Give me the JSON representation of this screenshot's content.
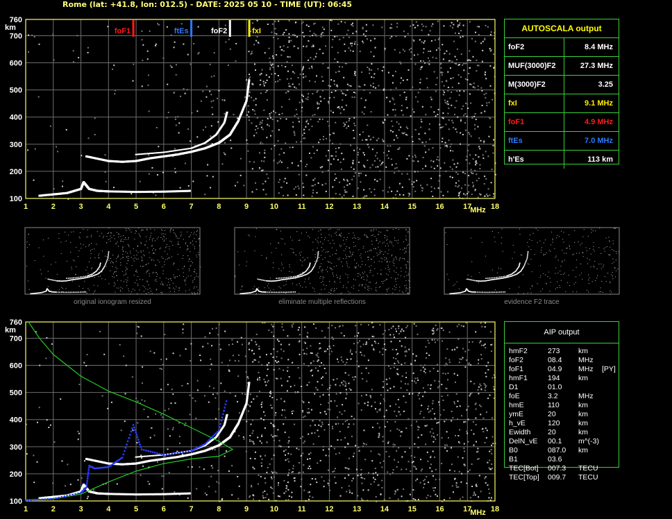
{
  "header": {
    "title": "Rome (lat: +41.8, lon: 012.5) - DATE: 2025 05 10 - TIME (UT): 06:45"
  },
  "axes": {
    "x_ticks": [
      "1",
      "2",
      "3",
      "4",
      "5",
      "6",
      "7",
      "8",
      "9",
      "10",
      "11",
      "12",
      "13",
      "14",
      "15",
      "16",
      "17",
      "18"
    ],
    "x_unit": "MHz",
    "y_ticks": [
      "100",
      "200",
      "300",
      "400",
      "500",
      "600",
      "700",
      "760"
    ],
    "y_unit": "km"
  },
  "markers": [
    {
      "label": "foF1",
      "freq": 4.9,
      "color": "#ff1a1a"
    },
    {
      "label": "ftEs",
      "freq": 7.0,
      "color": "#2a7bff"
    },
    {
      "label": "foF2",
      "freq": 8.4,
      "color": "#ffffff"
    },
    {
      "label": "fxI",
      "freq": 9.1,
      "color": "#ffee00"
    }
  ],
  "autoscala": {
    "title": "AUTOSCALA output",
    "rows": [
      {
        "k": "foF2",
        "v": "8.4 MHz",
        "color": "#ffffff"
      },
      {
        "k": "MUF(3000)F2",
        "v": "27.3 MHz",
        "color": "#ffffff"
      },
      {
        "k": "M(3000)F2",
        "v": "3.25",
        "color": "#ffffff"
      },
      {
        "k": "fxI",
        "v": "9.1 MHz",
        "color": "#ffee00"
      },
      {
        "k": "foF1",
        "v": "4.9 MHz",
        "color": "#ff1a1a"
      },
      {
        "k": "ftEs",
        "v": "7.0 MHz",
        "color": "#2a7bff"
      },
      {
        "k": "h'Es",
        "v": "113   km",
        "color": "#ffffff"
      }
    ]
  },
  "thumbs": [
    {
      "caption": "original ionogram resized"
    },
    {
      "caption": "eliminate multiple reflections"
    },
    {
      "caption": "evidence F2 trace"
    }
  ],
  "aip": {
    "title": "AIP output",
    "rows": [
      {
        "n": "hmF2",
        "v": "273",
        "u": "km",
        "x": ""
      },
      {
        "n": "foF2",
        "v": "08.4",
        "u": "MHz",
        "x": ""
      },
      {
        "n": "foF1",
        "v": "04.9",
        "u": "MHz",
        "x": "[PY]"
      },
      {
        "n": "hmF1",
        "v": "194",
        "u": "km",
        "x": ""
      },
      {
        "n": "D1",
        "v": "01.0",
        "u": "",
        "x": ""
      },
      {
        "n": "foE",
        "v": "3.2",
        "u": "MHz",
        "x": ""
      },
      {
        "n": "hmE",
        "v": "110",
        "u": "km",
        "x": ""
      },
      {
        "n": "ymE",
        "v": "20",
        "u": "km",
        "x": ""
      },
      {
        "n": "h_vE",
        "v": "120",
        "u": "km",
        "x": ""
      },
      {
        "n": "Ewidth",
        "v": "20",
        "u": "km",
        "x": ""
      },
      {
        "n": "DelN_vE",
        "v": "00.1",
        "u": "m^(-3)",
        "x": ""
      },
      {
        "n": "B0",
        "v": "087.0",
        "u": "km",
        "x": ""
      },
      {
        "n": "B1",
        "v": "03.6",
        "u": "",
        "x": ""
      },
      {
        "n": "TEC[Bot]",
        "v": "007.3",
        "u": "TECU",
        "x": ""
      },
      {
        "n": "TEC[Top]",
        "v": "009.7",
        "u": "TECU",
        "x": ""
      }
    ]
  },
  "chart_data": [
    {
      "type": "scatter",
      "ylabel": "km",
      "xlabel": "MHz",
      "xlim": [
        1,
        18
      ],
      "ylim": [
        100,
        760
      ],
      "grid": true,
      "series": [
        {
          "values": [
            [
              1.5,
              110
            ],
            [
              2.0,
              115
            ],
            [
              2.5,
              120
            ],
            [
              3.0,
              135
            ],
            [
              3.1,
              160
            ],
            [
              3.3,
              135
            ],
            [
              3.6,
              128
            ],
            [
              4.0,
              126
            ],
            [
              5.0,
              124
            ],
            [
              6.0,
              125
            ],
            [
              7.0,
              128
            ]
          ]
        },
        {
          "values": [
            [
              3.2,
              255
            ],
            [
              4.0,
              238
            ],
            [
              4.5,
              235
            ],
            [
              5.0,
              238
            ],
            [
              5.5,
              248
            ],
            [
              6.0,
              255
            ],
            [
              6.5,
              262
            ],
            [
              7.0,
              272
            ],
            [
              7.5,
              285
            ],
            [
              8.0,
              305
            ],
            [
              8.4,
              335
            ],
            [
              8.7,
              385
            ],
            [
              9.0,
              460
            ],
            [
              9.1,
              540
            ]
          ]
        },
        {
          "values": [
            [
              5.0,
              262
            ],
            [
              6.0,
              270
            ],
            [
              7.0,
              285
            ],
            [
              7.5,
              305
            ],
            [
              7.9,
              335
            ],
            [
              8.2,
              380
            ],
            [
              8.3,
              420
            ]
          ]
        }
      ]
    },
    {
      "type": "line",
      "ylabel": "km",
      "xlabel": "MHz",
      "xlim": [
        1,
        18
      ],
      "ylim": [
        100,
        760
      ],
      "grid": true,
      "series": [
        {
          "color": "#22cc22",
          "values": [
            [
              1.1,
              760
            ],
            [
              1.5,
              700
            ],
            [
              2.0,
              640
            ],
            [
              3.0,
              560
            ],
            [
              4.0,
              505
            ],
            [
              5.0,
              465
            ],
            [
              6.0,
              420
            ],
            [
              7.0,
              370
            ],
            [
              8.0,
              320
            ],
            [
              8.5,
              290
            ],
            [
              8.0,
              265
            ],
            [
              7.0,
              255
            ],
            [
              6.0,
              238
            ],
            [
              5.0,
              210
            ],
            [
              4.0,
              170
            ],
            [
              3.0,
              125
            ],
            [
              2.0,
              108
            ],
            [
              1.0,
              104
            ]
          ]
        },
        {
          "color": "#2a3cff",
          "values": [
            [
              1.0,
              102
            ],
            [
              2.0,
              108
            ],
            [
              3.0,
              130
            ],
            [
              3.2,
              150
            ],
            [
              3.3,
              230
            ],
            [
              3.5,
              220
            ],
            [
              4.0,
              225
            ],
            [
              4.5,
              260
            ],
            [
              4.9,
              380
            ],
            [
              5.2,
              290
            ],
            [
              6.0,
              270
            ],
            [
              7.0,
              285
            ],
            [
              7.5,
              310
            ],
            [
              8.0,
              360
            ],
            [
              8.3,
              480
            ]
          ]
        }
      ]
    }
  ]
}
